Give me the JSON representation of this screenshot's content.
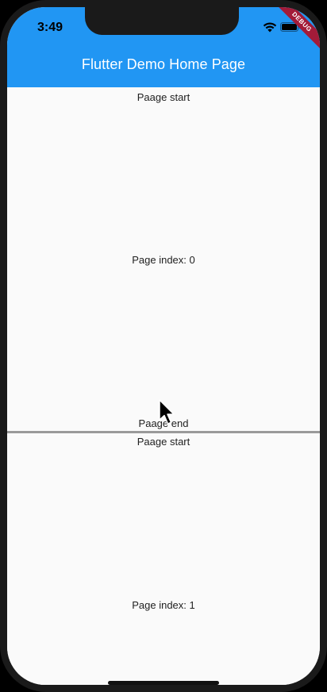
{
  "status_bar": {
    "time": "3:49"
  },
  "app_bar": {
    "title": "Flutter Demo Home Page",
    "background_color": "#2196f3"
  },
  "debug_banner": {
    "label": "DEBUG",
    "color": "#a31b39"
  },
  "pages": [
    {
      "start_label": "Paage start",
      "index_label": "Page index: 0",
      "end_label": "Paage end"
    },
    {
      "start_label": "Paage start",
      "index_label": "Page index: 1"
    }
  ],
  "icons": {
    "wifi": "wifi-icon",
    "battery": "battery-icon",
    "cursor": "mouse-pointer-icon"
  }
}
